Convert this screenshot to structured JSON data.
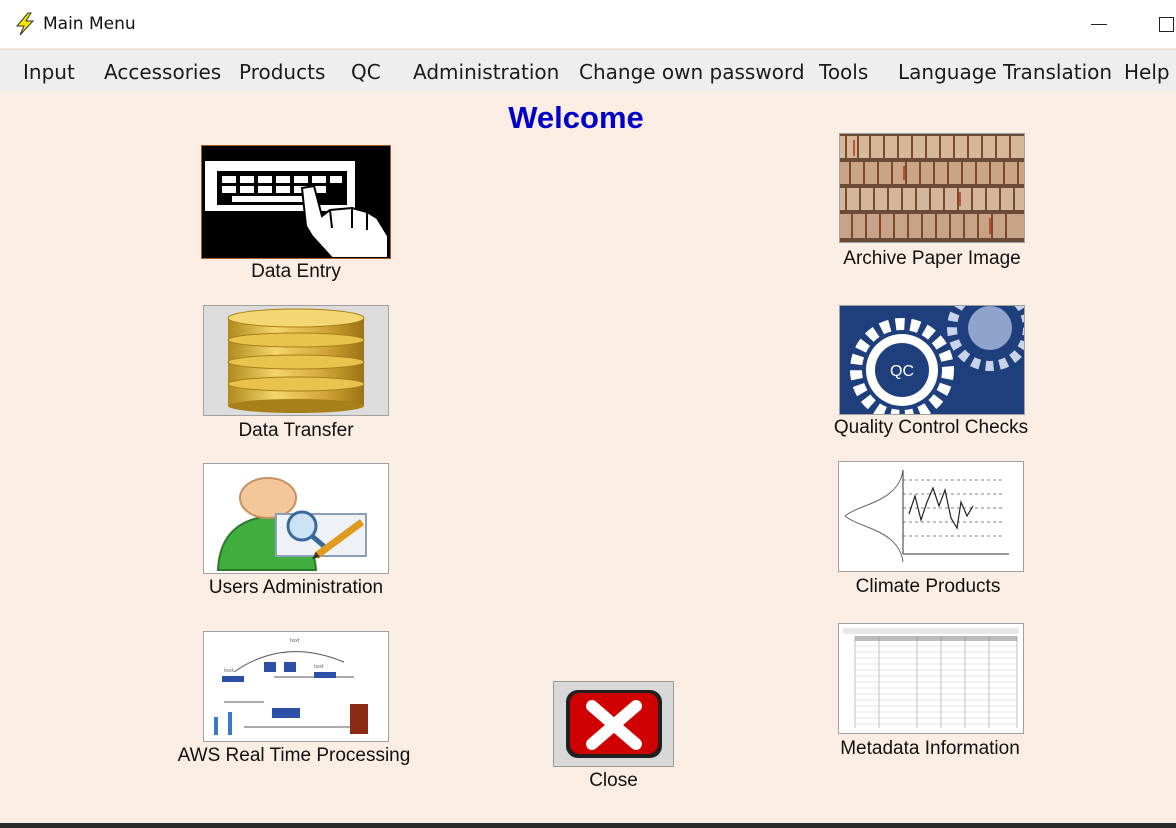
{
  "window": {
    "title": "Main Menu"
  },
  "menu": [
    {
      "label": "Input"
    },
    {
      "label": "Accessories"
    },
    {
      "label": "Products"
    },
    {
      "label": "QC"
    },
    {
      "label": "Administration"
    },
    {
      "label": "Change own password"
    },
    {
      "label": "Tools"
    },
    {
      "label": "Language Translation"
    },
    {
      "label": "Help"
    }
  ],
  "welcome": "Welcome",
  "tiles": {
    "data_entry": {
      "label": "Data Entry",
      "icon": "keyboard-hand-icon"
    },
    "data_transfer": {
      "label": "Data Transfer",
      "icon": "database-icon"
    },
    "users_admin": {
      "label": "Users Administration",
      "icon": "user-admin-icon"
    },
    "aws": {
      "label": "AWS Real Time Processing",
      "icon": "aws-diagram-icon"
    },
    "archive": {
      "label": "Archive Paper Image",
      "icon": "paper-archive-icon"
    },
    "qc": {
      "label": "Quality Control Checks",
      "icon": "qc-gear-icon",
      "badge": "QC"
    },
    "climate": {
      "label": "Climate Products",
      "icon": "climate-chart-icon"
    },
    "metadata": {
      "label": "Metadata Information",
      "icon": "metadata-table-icon"
    },
    "close": {
      "label": "Close",
      "icon": "close-x-icon"
    }
  },
  "colors": {
    "background": "#f9ede4",
    "welcome": "#0000c8",
    "close_red": "#d10000"
  }
}
